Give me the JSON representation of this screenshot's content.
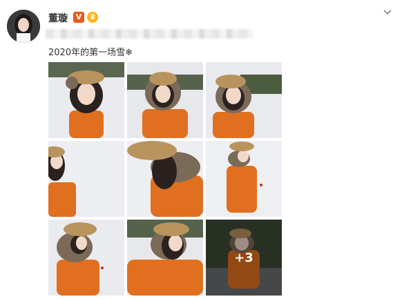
{
  "user": {
    "name": "董璇",
    "verified_badge": "V"
  },
  "post": {
    "text": "2020年的第一场雪❄"
  },
  "photos": [
    {
      "name": "photo-1"
    },
    {
      "name": "photo-2"
    },
    {
      "name": "photo-3"
    },
    {
      "name": "photo-4"
    },
    {
      "name": "photo-5"
    },
    {
      "name": "photo-6"
    },
    {
      "name": "photo-7"
    },
    {
      "name": "photo-8"
    },
    {
      "name": "photo-9",
      "more_count": "+3"
    }
  ],
  "colors": {
    "snow": "#e9ebef",
    "jacket": "#e0701f",
    "hat": "#b9935e",
    "fur": "#7b6a58",
    "hair": "#2b2220",
    "hedge": "#4b5c3f"
  }
}
